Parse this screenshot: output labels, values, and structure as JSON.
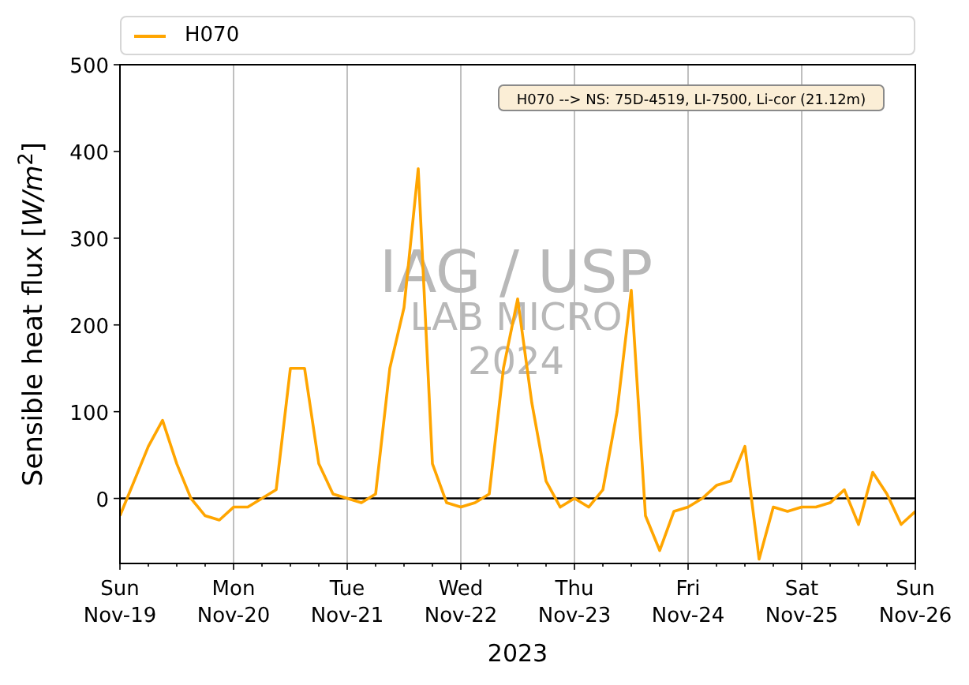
{
  "chart_data": {
    "type": "line",
    "ylabel": "Sensible heat flux [*W/m*$^{2}$]",
    "xlabel": "2023",
    "categories": [
      "Sun Nov-19",
      null,
      null,
      null,
      null,
      null,
      null,
      null,
      "Mon Nov-20",
      null,
      null,
      null,
      null,
      null,
      null,
      null,
      "Tue Nov-21",
      null,
      null,
      null,
      null,
      null,
      null,
      null,
      "Wed Nov-22",
      null,
      null,
      null,
      null,
      null,
      null,
      null,
      "Thu Nov-23",
      null,
      null,
      null,
      null,
      null,
      null,
      null,
      "Fri Nov-24",
      null,
      null,
      null,
      null,
      null,
      null,
      null,
      "Sat Nov-25",
      null,
      null,
      null,
      null,
      null,
      null,
      null,
      "Sun Nov-26"
    ],
    "series": [
      {
        "name": "H070",
        "color": "#ffa500",
        "values": [
          -20,
          20,
          60,
          90,
          40,
          0,
          -20,
          -25,
          -10,
          -10,
          0,
          10,
          150,
          150,
          40,
          5,
          0,
          -5,
          5,
          150,
          220,
          380,
          40,
          -5,
          -10,
          -5,
          5,
          150,
          230,
          110,
          20,
          -10,
          0,
          -10,
          10,
          100,
          240,
          -20,
          -60,
          -15,
          -10,
          0,
          15,
          20,
          60,
          -70,
          -10,
          -15,
          -10,
          -10,
          -5,
          10,
          -30,
          30,
          5,
          -30,
          -15
        ]
      }
    ],
    "grid": "x",
    "ylim": [
      -75,
      500
    ],
    "yticks": [
      0,
      100,
      200,
      300,
      400,
      500
    ],
    "annotations": [
      "H070 --> NS: 75D-4519, LI-7500, Li-cor (21.12m)"
    ]
  },
  "watermark": [
    "IAG / USP",
    "LAB MICRO",
    "2024"
  ]
}
